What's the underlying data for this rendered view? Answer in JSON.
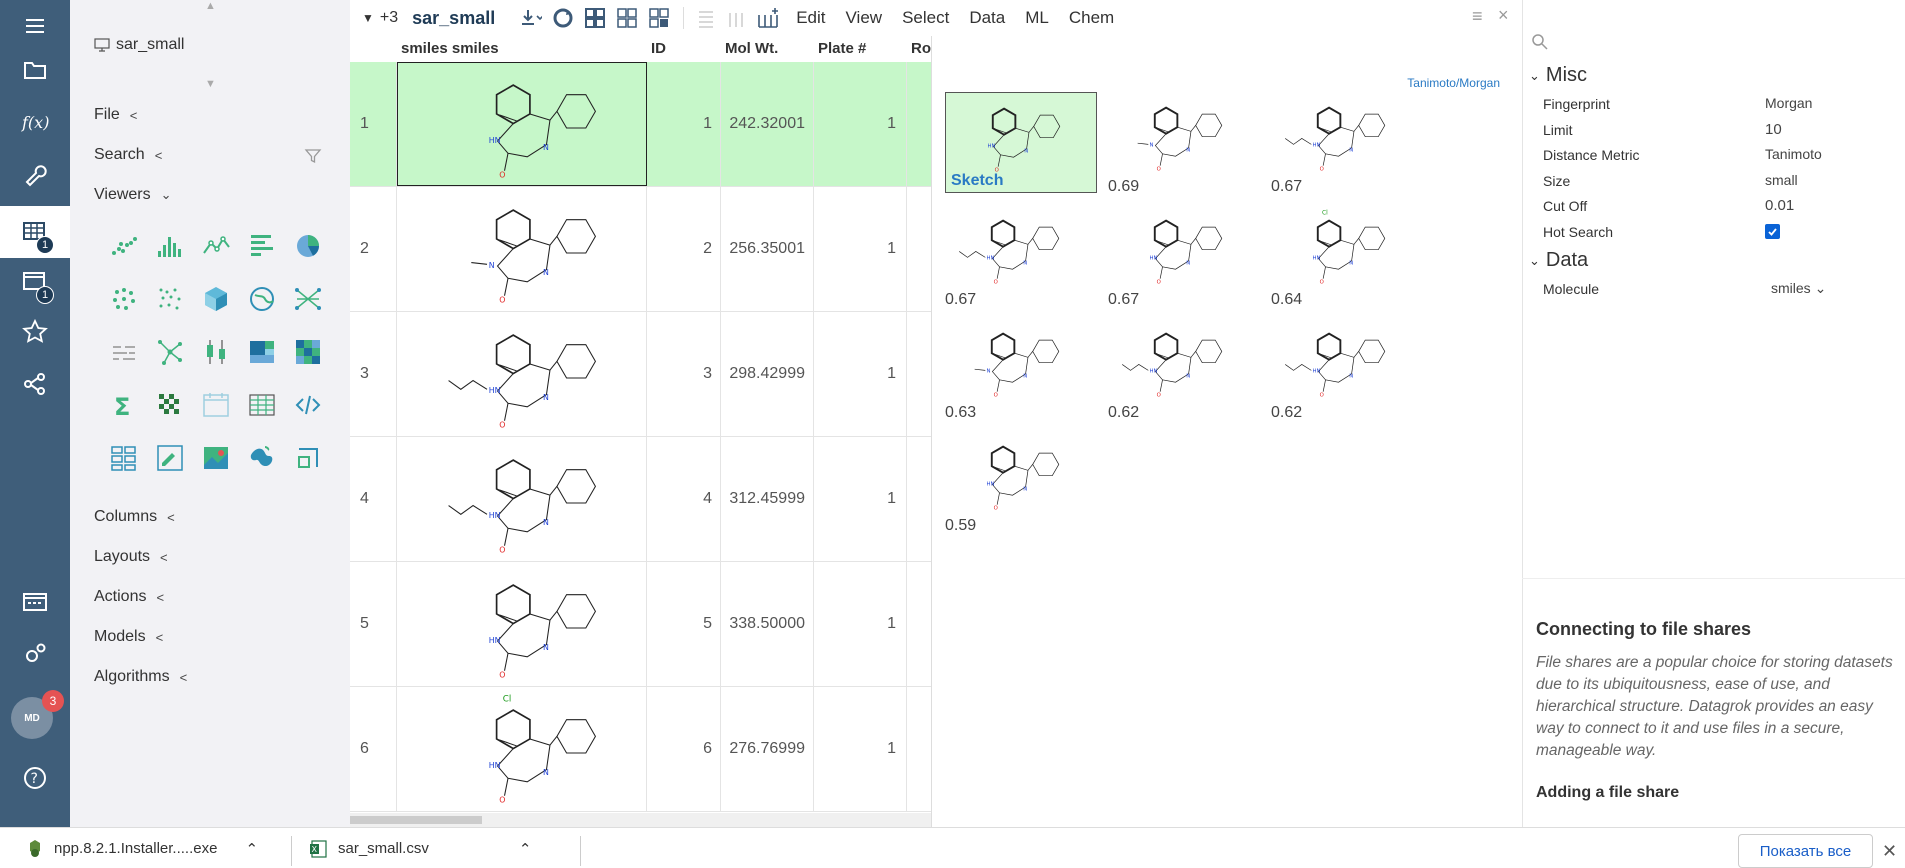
{
  "rail": {
    "items": [
      "menu-icon",
      "folder-icon",
      "function-icon",
      "wrench-icon",
      "table-icon",
      "dashboard-icon",
      "star-icon",
      "share-icon",
      "browser-icon",
      "settings-icon",
      "help-icon"
    ],
    "table_badge": "1",
    "dashboard_badge": "1",
    "avatar": "MD",
    "avatar_badge": "3"
  },
  "side": {
    "project": "sar_small",
    "sections": {
      "file": "File",
      "search": "Search",
      "viewers": "Viewers",
      "columns": "Columns",
      "layouts": "Layouts",
      "actions": "Actions",
      "models": "Models",
      "algorithms": "Algorithms"
    }
  },
  "toolbar": {
    "more": "+3",
    "title": "sar_small",
    "menus": [
      "Edit",
      "View",
      "Select",
      "Data",
      "ML",
      "Chem"
    ]
  },
  "grid": {
    "headers": [
      "",
      "smiles smiles",
      "ID",
      "Mol Wt.",
      "Plate #",
      "Row"
    ],
    "rows": [
      {
        "idx": "1",
        "id": "1",
        "mw": "242.32001",
        "plate": "1"
      },
      {
        "idx": "2",
        "id": "2",
        "mw": "256.35001",
        "plate": "1"
      },
      {
        "idx": "3",
        "id": "3",
        "mw": "298.42999",
        "plate": "1"
      },
      {
        "idx": "4",
        "id": "4",
        "mw": "312.45999",
        "plate": "1"
      },
      {
        "idx": "5",
        "id": "5",
        "mw": "338.50000",
        "plate": "1"
      },
      {
        "idx": "6",
        "id": "6",
        "mw": "276.76999",
        "plate": "1"
      }
    ]
  },
  "similarity": {
    "method": "Tanimoto/Morgan",
    "reference_label": "Sketch",
    "scores": [
      "0.69",
      "0.67",
      "0.67",
      "0.67",
      "0.64",
      "0.63",
      "0.62",
      "0.62",
      "0.59"
    ]
  },
  "props": {
    "misc_title": "Misc",
    "data_title": "Data",
    "misc": [
      {
        "k": "Fingerprint",
        "v": "Morgan"
      },
      {
        "k": "Limit",
        "v": "10"
      },
      {
        "k": "Distance Metric",
        "v": "Tanimoto"
      },
      {
        "k": "Size",
        "v": "small"
      },
      {
        "k": "Cut Off",
        "v": "0.01"
      },
      {
        "k": "Hot Search",
        "v": ""
      }
    ],
    "data": [
      {
        "k": "Molecule",
        "v": "smiles"
      }
    ]
  },
  "help": {
    "title": "Connecting to file shares",
    "body": "File shares are a popular choice for storing datasets due to its ubiquitousness, ease of use, and hierarchical structure. Datagrok provides an easy way to connect to it and use files in a secure, manageable way.",
    "subtitle": "Adding a file share"
  },
  "downloads": {
    "items": [
      "npp.8.2.1.Installer.....exe",
      "sar_small.csv"
    ],
    "show_all": "Показать все"
  },
  "colors": {
    "rail": "#3f5e7a",
    "selected_row": "#c6f7c9",
    "accent": "#2a7ac4",
    "green_icon": "#3fb37f"
  }
}
